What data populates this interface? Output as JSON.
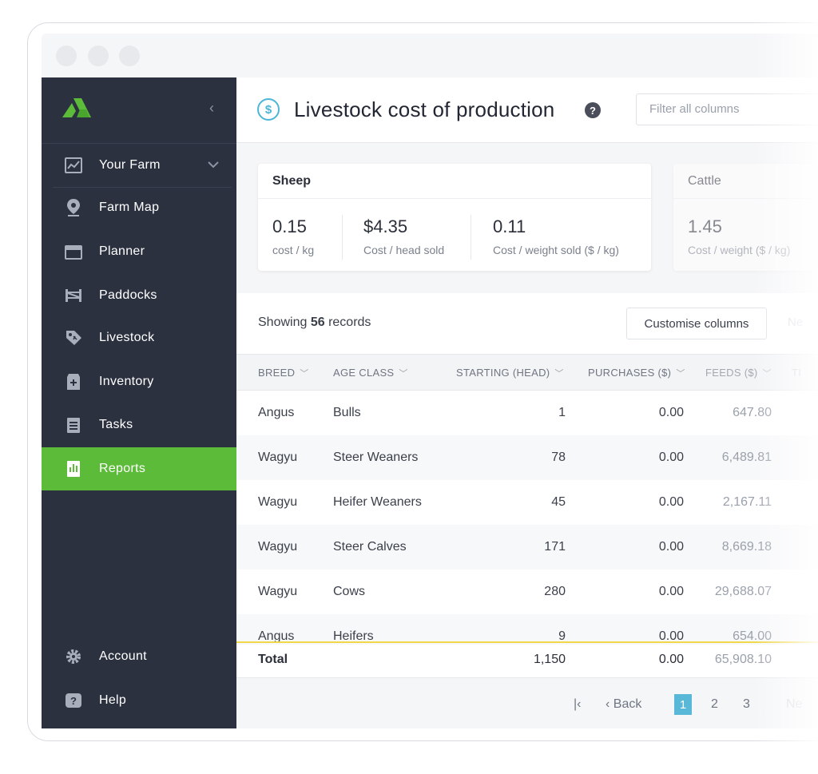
{
  "sidebar": {
    "collapse_glyph": "‹",
    "items": [
      {
        "label": "Your Farm",
        "icon": "dashboard-icon"
      },
      {
        "label": "Farm Map",
        "icon": "map-pin-icon"
      },
      {
        "label": "Planner",
        "icon": "calendar-icon"
      },
      {
        "label": "Paddocks",
        "icon": "fence-icon"
      },
      {
        "label": "Livestock",
        "icon": "tag-icon"
      },
      {
        "label": "Inventory",
        "icon": "box-icon"
      },
      {
        "label": "Tasks",
        "icon": "clipboard-icon"
      },
      {
        "label": "Reports",
        "icon": "report-icon",
        "active": true
      },
      {
        "label": "Account",
        "icon": "gear-icon"
      },
      {
        "label": "Help",
        "icon": "help-icon"
      }
    ]
  },
  "header": {
    "icon_glyph": "$",
    "title": "Livestock cost of production",
    "help_glyph": "?",
    "filter_placeholder": "Filter all columns"
  },
  "cards": {
    "sheep": {
      "title": "Sheep",
      "stats": [
        {
          "value": "0.15",
          "label": "cost / kg"
        },
        {
          "value": "$4.35",
          "label": "Cost / head sold"
        },
        {
          "value": "0.11",
          "label": "Cost / weight sold ($ / kg)"
        }
      ]
    },
    "cattle": {
      "title": "Cattle",
      "stats": [
        {
          "value": "1.45",
          "label": "Cost / weight ($ / kg)"
        }
      ]
    }
  },
  "records": {
    "prefix": "Showing",
    "count": "56",
    "suffix": "records",
    "customise_label": "Customise columns",
    "ghost_label": "Ne"
  },
  "table": {
    "columns": [
      "BREED",
      "AGE CLASS",
      "STARTING (HEAD)",
      "PURCHASES ($)",
      "FEEDS ($)",
      "TI"
    ],
    "rows": [
      [
        "Angus",
        "Bulls",
        "1",
        "0.00",
        "647.80"
      ],
      [
        "Wagyu",
        "Steer Weaners",
        "78",
        "0.00",
        "6,489.81"
      ],
      [
        "Wagyu",
        "Heifer Weaners",
        "45",
        "0.00",
        "2,167.11"
      ],
      [
        "Wagyu",
        "Steer Calves",
        "171",
        "0.00",
        "8,669.18"
      ],
      [
        "Wagyu",
        "Cows",
        "280",
        "0.00",
        "29,688.07"
      ],
      [
        "Angus",
        "Heifers",
        "9",
        "0.00",
        "654.00"
      ]
    ],
    "total": {
      "label": "Total",
      "starting": "1,150",
      "purchases": "0.00",
      "feeds": "65,908.10"
    }
  },
  "pager": {
    "first_glyph": "|‹",
    "back_label": "‹  Back",
    "pages": [
      "1",
      "2",
      "3"
    ],
    "current": "1",
    "next_label": "Ne"
  },
  "colors": {
    "sidebar_bg": "#2c3140",
    "active_green": "#5dbb3a",
    "accent_blue": "#59b8d8",
    "logo_green": "#5dbb3a"
  }
}
